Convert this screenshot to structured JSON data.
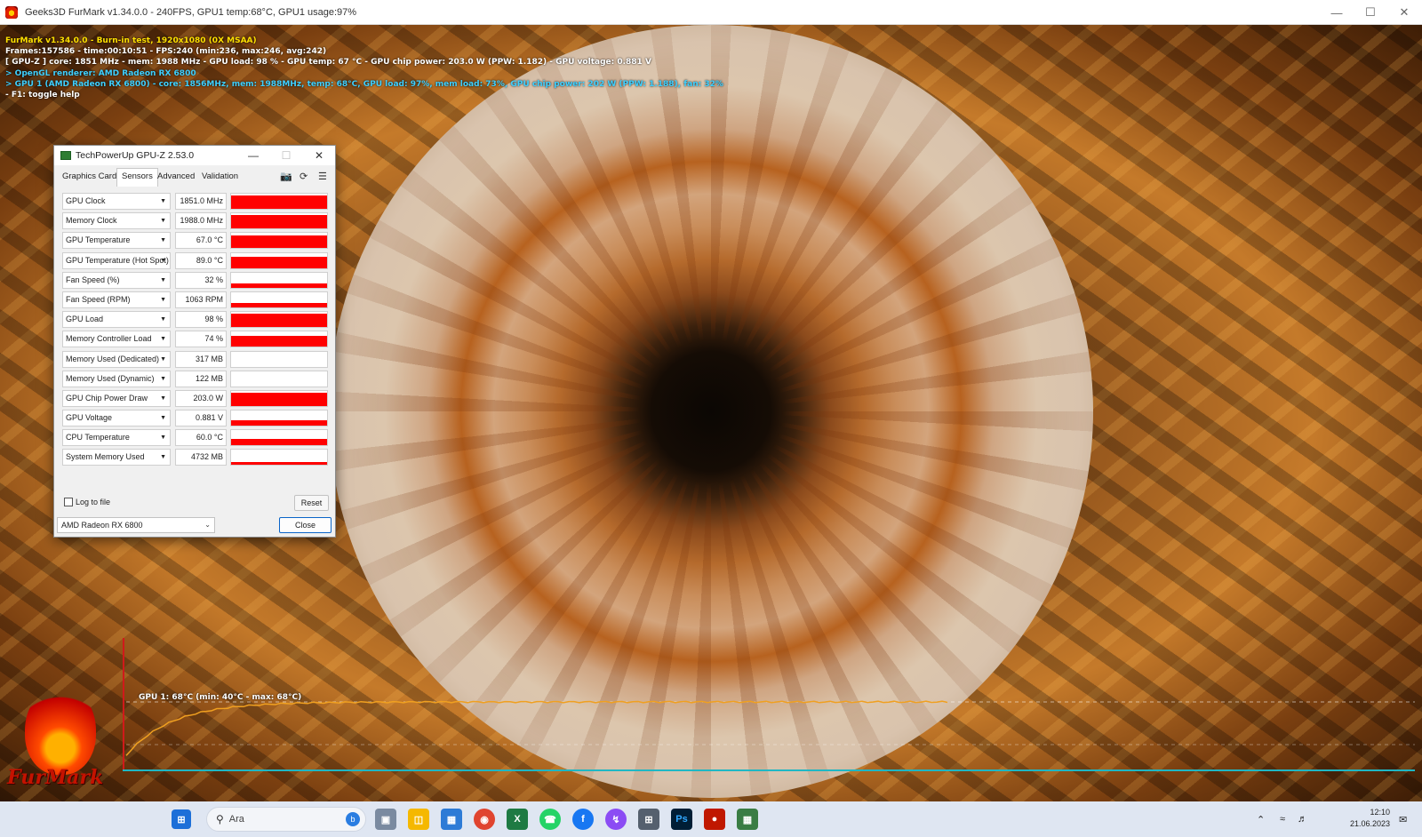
{
  "furmark": {
    "window_title": "Geeks3D FurMark v1.34.0.0 - 240FPS, GPU1 temp:68°C, GPU1 usage:97%",
    "overlay_lines": [
      {
        "text": "FurMark v1.34.0.0 - Burn-in test, 1920x1080 (0X MSAA)",
        "color": "#ffe000"
      },
      {
        "text": "Frames:157586 - time:00:10:51 - FPS:240 (min:236, max:246, avg:242)",
        "color": "#ffffff"
      },
      {
        "text": "[ GPU-Z ] core: 1851 MHz - mem: 1988 MHz - GPU load: 98 % - GPU temp: 67 °C - GPU chip power: 203.0 W (PPW: 1.182) - GPU voltage: 0.881 V",
        "color": "#ffffff"
      },
      {
        "text": "> OpenGL renderer: AMD Radeon RX 6800",
        "color": "#3fd0ff"
      },
      {
        "text": "> GPU 1 (AMD Radeon RX 6800) - core: 1856MHz, mem: 1988MHz, temp: 68°C, GPU load: 97%, mem load: 73%, GPU chip power: 202 W (PPW: 1.188), fan: 32%",
        "color": "#3fd0ff"
      },
      {
        "text": "- F1: toggle help",
        "color": "#ffffff"
      }
    ],
    "logo_text": "FurMark",
    "temp_graph_label": "GPU 1: 68°C (min: 40°C - max: 68°C)",
    "temp_graph_color": "#f0a020"
  },
  "gpuz": {
    "title": "TechPowerUp GPU-Z 2.53.0",
    "tabs": [
      "Graphics Card",
      "Sensors",
      "Advanced",
      "Validation"
    ],
    "active_tab": "Sensors",
    "sensors": [
      {
        "name": "GPU Clock",
        "value": "1851.0 MHz",
        "level": 0.9
      },
      {
        "name": "Memory Clock",
        "value": "1988.0 MHz",
        "level": 0.9
      },
      {
        "name": "GPU Temperature",
        "value": "67.0 °C",
        "level": 0.85
      },
      {
        "name": "GPU Temperature (Hot Spot)",
        "value": "89.0 °C",
        "level": 0.75
      },
      {
        "name": "Fan Speed (%)",
        "value": "32 %",
        "level": 0.3
      },
      {
        "name": "Fan Speed (RPM)",
        "value": "1063 RPM",
        "level": 0.3
      },
      {
        "name": "GPU Load",
        "value": "98 %",
        "level": 0.92
      },
      {
        "name": "Memory Controller Load",
        "value": "74 %",
        "level": 0.7
      },
      {
        "name": "Memory Used (Dedicated)",
        "value": "317 MB",
        "level": 0.0
      },
      {
        "name": "Memory Used (Dynamic)",
        "value": "122 MB",
        "level": 0.0
      },
      {
        "name": "GPU Chip Power Draw",
        "value": "203.0 W",
        "level": 0.85
      },
      {
        "name": "GPU Voltage",
        "value": "0.881 V",
        "level": 0.35
      },
      {
        "name": "CPU Temperature",
        "value": "60.0 °C",
        "level": 0.45
      },
      {
        "name": "System Memory Used",
        "value": "4732 MB",
        "level": 0.2
      }
    ],
    "log_to_file": "Log to file",
    "reset": "Reset",
    "gpu_select": "AMD Radeon RX 6800",
    "close": "Close",
    "bar_color": "#ff0000"
  },
  "taskbar": {
    "search_placeholder": "Ara",
    "time": "12:10",
    "date": "21.06.2023"
  }
}
